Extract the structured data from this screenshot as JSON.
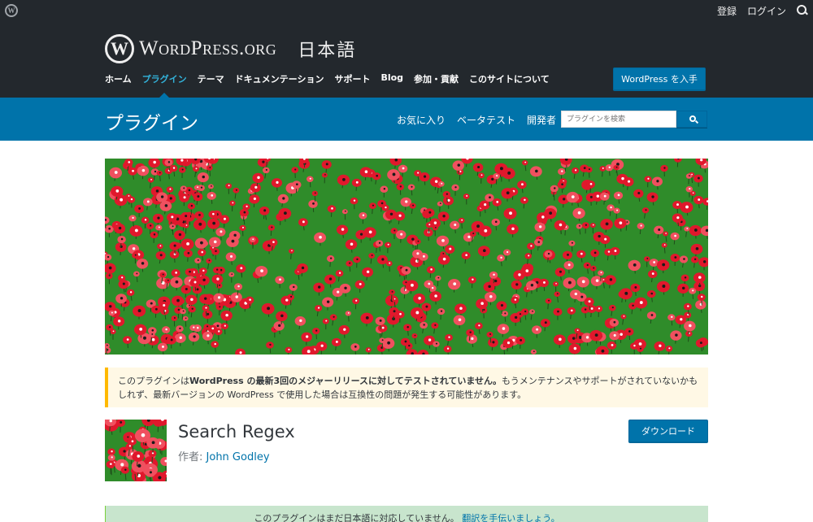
{
  "adminbar": {
    "logo_icon": "wordpress-logo-icon",
    "links": [
      "登録",
      "ログイン"
    ],
    "search_icon": "search-icon"
  },
  "header": {
    "logo_mark": "W",
    "logo_text": "WordPress.org",
    "logo_locale": "日本語",
    "nav": [
      "ホーム",
      "プラグイン",
      "テーマ",
      "ドキュメンテーション",
      "サポート",
      "Blog",
      "参加・貢献",
      "このサイトについて"
    ],
    "nav_active": "プラグイン",
    "get_wordpress": "WordPress を入手"
  },
  "subheader": {
    "title": "プラグイン",
    "nav": [
      "お気に入り",
      "ベータテスト",
      "開発者"
    ],
    "search_placeholder": "プラグインを検索",
    "search_icon": "search-icon"
  },
  "notice": {
    "lead": "このプラグインは",
    "bold": "WordPress の最新3回のメジャーリリースに対してテストされていません。",
    "rest": "もうメンテナンスやサポートがされていないかもしれず、最新バージョンの WordPress で使用した場合は互換性の問題が発生する可能性があります。"
  },
  "plugin": {
    "name": "Search Regex",
    "author_label": "作者:",
    "author": "John Godley",
    "download_label": "ダウンロード"
  },
  "translation_notice": {
    "text": "このプラグインはまだ日本語に対応していません。",
    "link": "翻訳を手伝いましょう。"
  },
  "colors": {
    "header_bg": "#23282d",
    "accent_blue": "#0073aa",
    "nav_active": "#33b3db",
    "notice_bg": "#fff8e5",
    "notice_border": "#ffb900",
    "translate_bg": "#c8e5cd",
    "banner_green": "#2f8c2a",
    "poppy_red": "#e0182c"
  }
}
